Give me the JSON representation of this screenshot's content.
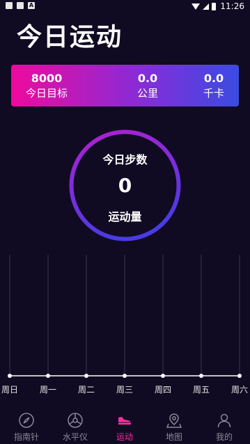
{
  "status_bar": {
    "time": "11:26",
    "icons": [
      "image-icon",
      "sd-card-icon",
      "a-icon",
      "wifi-icon",
      "signal-icon",
      "battery-icon"
    ]
  },
  "page_title": "今日运动",
  "stats": [
    {
      "value": "8000",
      "label": "今日目标"
    },
    {
      "value": "0.0",
      "label": "公里"
    },
    {
      "value": "0.0",
      "label": "千卡"
    }
  ],
  "ring": {
    "title": "今日步数",
    "steps": "0",
    "subtitle": "运动量"
  },
  "chart_data": {
    "type": "line",
    "categories": [
      "周日",
      "周一",
      "周二",
      "周三",
      "周四",
      "周五",
      "周六"
    ],
    "values": [
      0,
      0,
      0,
      0,
      0,
      0,
      0
    ]
  },
  "tabs": [
    {
      "label": "指南针",
      "icon": "compass-icon",
      "active": false
    },
    {
      "label": "水平仪",
      "icon": "level-icon",
      "active": false
    },
    {
      "label": "运动",
      "icon": "shoe-icon",
      "active": true
    },
    {
      "label": "地图",
      "icon": "map-pin-icon",
      "active": false
    },
    {
      "label": "我的",
      "icon": "user-icon",
      "active": false
    }
  ],
  "colors": {
    "background": "#100b22",
    "gradient_start": "#ee0a9d",
    "gradient_mid": "#8a2bd6",
    "gradient_end": "#3a4be2",
    "tab_active": "#ff2fa0",
    "tab_inactive": "#8a8798"
  }
}
